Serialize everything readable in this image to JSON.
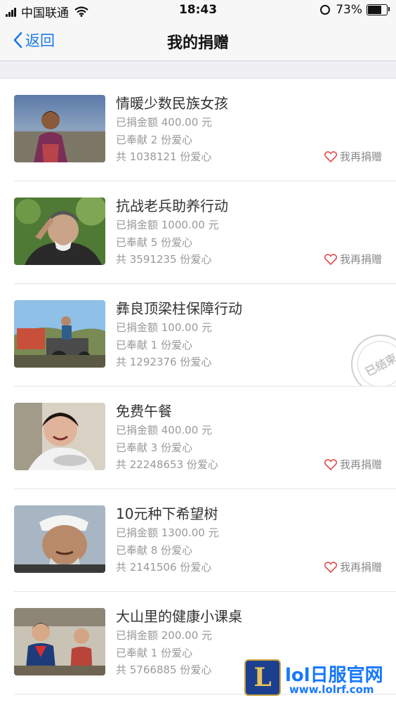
{
  "status_bar": {
    "carrier": "中国联通",
    "time": "18:43",
    "battery_text": "73%",
    "battery_level": 0.73
  },
  "nav": {
    "back_label": "返回",
    "title": "我的捐赠"
  },
  "donations": [
    {
      "title": "情暖少数民族女孩",
      "amount": "已捐金额 400.00 元",
      "times": "已奉献 2 份爱心",
      "total": "共 1038121 份爱心",
      "action": "我再捐赠",
      "image": "girl-portrait"
    },
    {
      "title": "抗战老兵助养行动",
      "amount": "已捐金额 1000.00 元",
      "times": "已奉献 5 份爱心",
      "total": "共 3591235 份爱心",
      "action": "我再捐赠",
      "image": "veteran-salute"
    },
    {
      "title": "彝良顶梁柱保障行动",
      "amount": "已捐金额 100.00 元",
      "times": "已奉献 1 份爱心",
      "total": "共 1292376 份爱心",
      "stamp": "已结束",
      "image": "farmer-tractor"
    },
    {
      "title": "免费午餐",
      "amount": "已捐金额 400.00 元",
      "times": "已奉献 3 份爱心",
      "total": "共 22248653 份爱心",
      "action": "我再捐赠",
      "image": "child-eating"
    },
    {
      "title": "10元种下希望树",
      "amount": "已捐金额 1300.00 元",
      "times": "已奉献 8 份爱心",
      "total": "共 2141506 份爱心",
      "action": "我再捐赠",
      "image": "elder-man"
    },
    {
      "title": "大山里的健康小课桌",
      "amount": "已捐金额 200.00 元",
      "times": "已奉献 1 份爱心",
      "total": "共 5766885 份爱心",
      "image": "students-classroom"
    }
  ],
  "watermark": {
    "logo": "L",
    "title": "lol日服官网",
    "url": "www.lolrf.com"
  },
  "colors": {
    "accent": "#1a7ae8",
    "heart": "#e24b4b",
    "watermark": "#1677ff"
  }
}
